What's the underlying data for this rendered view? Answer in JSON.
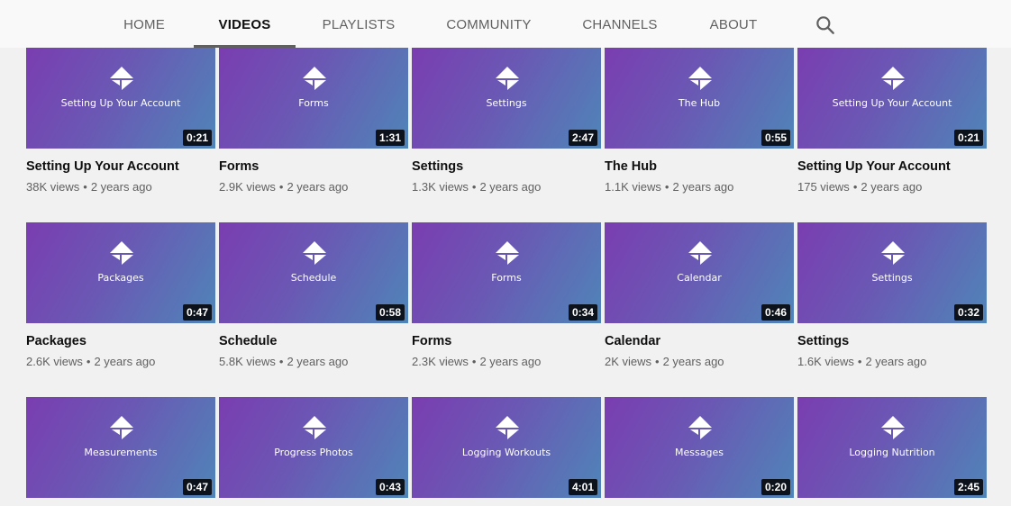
{
  "tabs": [
    {
      "label": "HOME",
      "active": false
    },
    {
      "label": "VIDEOS",
      "active": true
    },
    {
      "label": "PLAYLISTS",
      "active": false
    },
    {
      "label": "COMMUNITY",
      "active": false
    },
    {
      "label": "CHANNELS",
      "active": false
    },
    {
      "label": "ABOUT",
      "active": false
    }
  ],
  "search": {
    "icon": "search-icon"
  },
  "colors": {
    "thumb_start": "#7a3db0",
    "thumb_end": "#4f85b8",
    "tab_indicator": "#606060",
    "background": "#f1f1f1"
  },
  "videos": [
    {
      "thumb_caption": "Setting Up Your Account",
      "duration": "0:21",
      "title": "Setting Up Your Account",
      "views": "38K views",
      "age": "2 years ago"
    },
    {
      "thumb_caption": "Forms",
      "duration": "1:31",
      "title": "Forms",
      "views": "2.9K views",
      "age": "2 years ago"
    },
    {
      "thumb_caption": "Settings",
      "duration": "2:47",
      "title": "Settings",
      "views": "1.3K views",
      "age": "2 years ago"
    },
    {
      "thumb_caption": "The Hub",
      "duration": "0:55",
      "title": "The Hub",
      "views": "1.1K views",
      "age": "2 years ago"
    },
    {
      "thumb_caption": "Setting Up Your Account",
      "duration": "0:21",
      "title": "Setting Up Your Account",
      "views": "175 views",
      "age": "2 years ago"
    },
    {
      "thumb_caption": "Packages",
      "duration": "0:47",
      "title": "Packages",
      "views": "2.6K views",
      "age": "2 years ago"
    },
    {
      "thumb_caption": "Schedule",
      "duration": "0:58",
      "title": "Schedule",
      "views": "5.8K views",
      "age": "2 years ago"
    },
    {
      "thumb_caption": "Forms",
      "duration": "0:34",
      "title": "Forms",
      "views": "2.3K views",
      "age": "2 years ago"
    },
    {
      "thumb_caption": "Calendar",
      "duration": "0:46",
      "title": "Calendar",
      "views": "2K views",
      "age": "2 years ago"
    },
    {
      "thumb_caption": "Settings",
      "duration": "0:32",
      "title": "Settings",
      "views": "1.6K views",
      "age": "2 years ago"
    },
    {
      "thumb_caption": "Measurements",
      "duration": "0:47",
      "title": "",
      "views": "",
      "age": ""
    },
    {
      "thumb_caption": "Progress Photos",
      "duration": "0:43",
      "title": "",
      "views": "",
      "age": ""
    },
    {
      "thumb_caption": "Logging Workouts",
      "duration": "4:01",
      "title": "",
      "views": "",
      "age": ""
    },
    {
      "thumb_caption": "Messages",
      "duration": "0:20",
      "title": "",
      "views": "",
      "age": ""
    },
    {
      "thumb_caption": "Logging Nutrition",
      "duration": "2:45",
      "title": "",
      "views": "",
      "age": ""
    }
  ]
}
